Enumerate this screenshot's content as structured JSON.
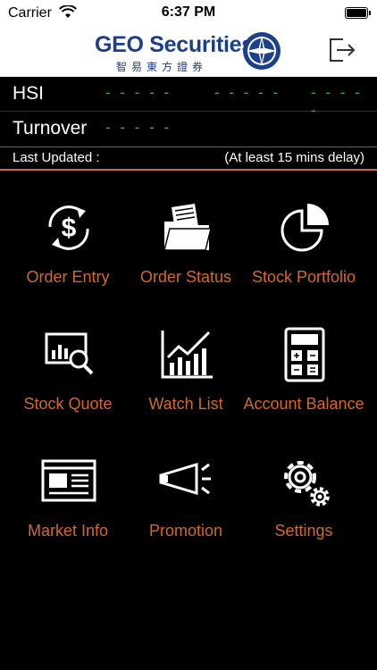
{
  "status_bar": {
    "carrier": "Carrier",
    "time": "6:37 PM"
  },
  "header": {
    "logo_text": "GEO Securities",
    "logo_subtitle": "智易東方證券"
  },
  "ticker": {
    "hsi_label": "HSI",
    "turnover_label": "Turnover",
    "placeholder": "- - - - -"
  },
  "update": {
    "label": "Last Updated :",
    "note": "(At least 15 mins delay)"
  },
  "menu": {
    "order_entry": "Order Entry",
    "order_status": "Order Status",
    "stock_portfolio": "Stock Portfolio",
    "stock_quote": "Stock Quote",
    "watch_list": "Watch List",
    "account_balance": "Account Balance",
    "market_info": "Market Info",
    "promotion": "Promotion",
    "settings": "Settings"
  },
  "colors": {
    "accent": "#d2692c",
    "brand_blue": "#1b3f8b",
    "ticker_green": "#4caf50"
  }
}
